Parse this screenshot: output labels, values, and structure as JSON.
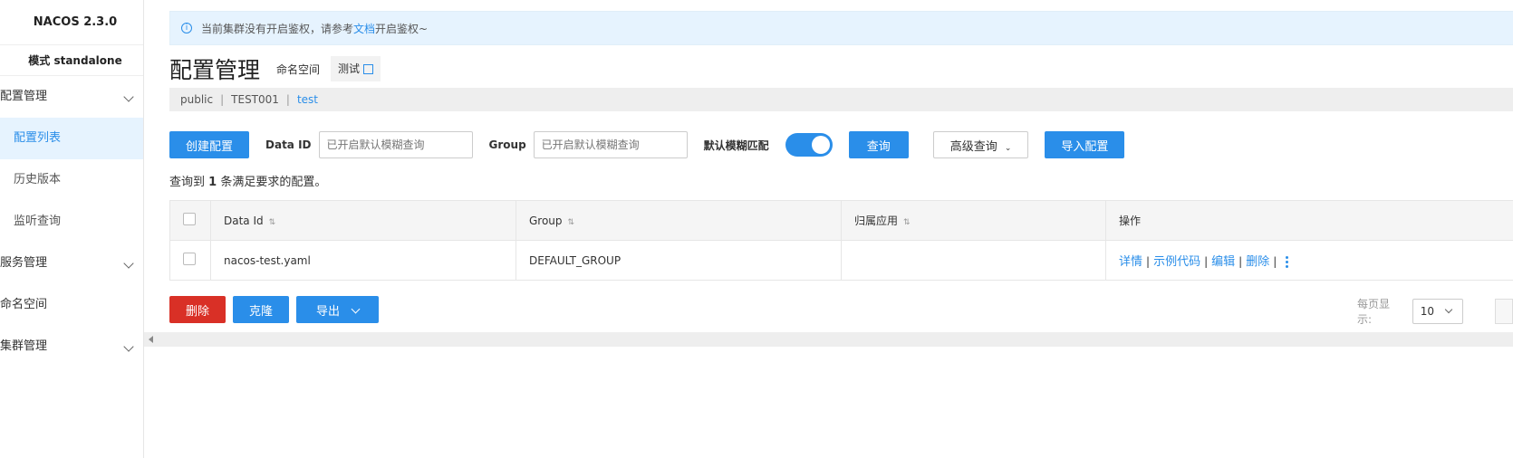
{
  "sidebar": {
    "brand": "NACOS 2.3.0",
    "mode": "模式 standalone",
    "config_group": "配置管理",
    "config_items": [
      "配置列表",
      "历史版本",
      "监听查询"
    ],
    "service_group": "服务管理",
    "namespace": "命名空间",
    "cluster_group": "集群管理"
  },
  "notice": {
    "prefix": "当前集群没有开启鉴权，请参考",
    "link": "文档",
    "suffix": "开启鉴权~"
  },
  "header": {
    "title": "配置管理",
    "namespace_label": "命名空间",
    "namespace_value": "测试"
  },
  "namespaces": {
    "items": [
      "public",
      "TEST001",
      "test"
    ]
  },
  "toolbar": {
    "create_label": "创建配置",
    "dataid_label": "Data ID",
    "dataid_placeholder": "已开启默认模糊查询",
    "group_label": "Group",
    "group_placeholder": "已开启默认模糊查询",
    "fuzzy_label": "默认模糊匹配",
    "fuzzy_on": true,
    "query_label": "查询",
    "advanced_label": "高级查询",
    "import_label": "导入配置"
  },
  "result": {
    "prefix": "查询到",
    "count": "1",
    "suffix": "条满足要求的配置。"
  },
  "table": {
    "columns": [
      "Data Id",
      "Group",
      "归属应用",
      "操作"
    ],
    "rows": [
      {
        "data_id": "nacos-test.yaml",
        "group": "DEFAULT_GROUP",
        "app": ""
      }
    ],
    "ops": [
      "详情",
      "示例代码",
      "编辑",
      "删除"
    ]
  },
  "actions": {
    "delete_label": "删除",
    "clone_label": "克隆",
    "export_label": "导出"
  },
  "pager": {
    "label": "每页显示:",
    "size": "10"
  },
  "colors": {
    "accent": "#2a8ee9",
    "danger": "#d93026",
    "notice_bg": "#e6f3fe"
  }
}
